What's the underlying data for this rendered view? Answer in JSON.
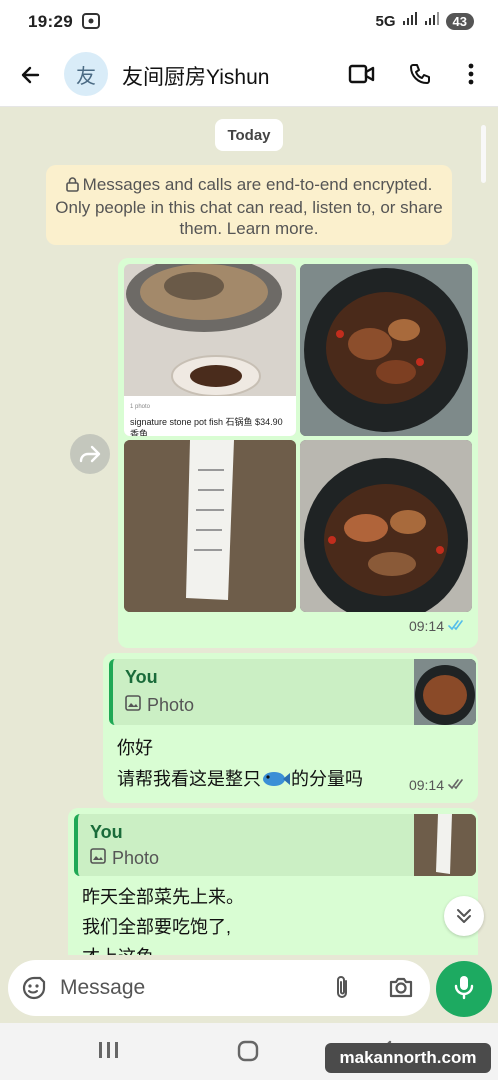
{
  "status": {
    "time": "19:29",
    "network": "5G",
    "battery": "43"
  },
  "header": {
    "avatar_letter": "友",
    "title": "友间厨房Yishun"
  },
  "chat": {
    "day_label": "Today",
    "encryption_notice": "Messages and calls are end-to-end encrypted. Only people in this chat can read, listen to, or share them. Learn more.",
    "album": {
      "time": "09:14",
      "photo_caption_small": "1 photo",
      "photo_caption": "signature stone pot fish 石锅鱼 $34.90",
      "photo_caption_tail": "香鱼"
    },
    "reply1": {
      "quote_author": "You",
      "quote_label": "Photo",
      "line1": "你好",
      "line2_before": "请帮我看这是整只",
      "line2_after": "的分量吗",
      "time": "09:14"
    },
    "reply2": {
      "quote_author": "You",
      "quote_label": "Photo",
      "line1": "昨天全部菜先上来。",
      "line2": "我们全部要吃饱了,",
      "line3": "才上这鱼"
    }
  },
  "input": {
    "placeholder": "Message"
  },
  "watermark": "makannorth.com"
}
